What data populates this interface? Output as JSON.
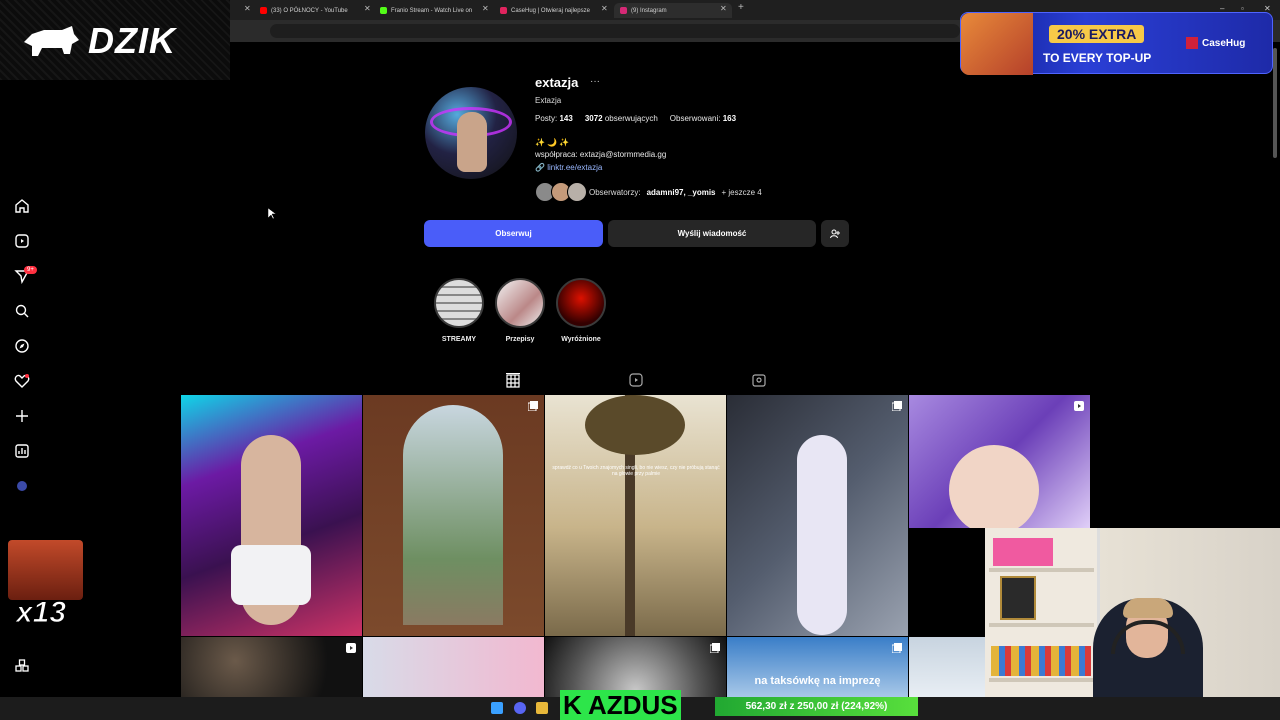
{
  "browser": {
    "tabs": [
      {
        "title": "(33) O PÓŁNOCY - YouTube",
        "color": "#ff0000"
      },
      {
        "title": "Franio Stream - Watch Live on",
        "color": "#53fc18"
      },
      {
        "title": "CaseHug | Otwieraj najlepsze ",
        "color": "#e0245e"
      },
      {
        "title": "(9) Instagram",
        "color": "#d62976"
      }
    ]
  },
  "overlay": {
    "brand": "DZIK",
    "casehug": {
      "pct": "20% EXTRA",
      "sub": "TO EVERY TOP-UP",
      "brand": "CaseHug"
    },
    "multiplier": "x13",
    "ticker_name": "K AZDUS",
    "donation": "562,30 zł z 250,00 zł (224,92%)"
  },
  "sidebar": {
    "badge": "9+"
  },
  "profile": {
    "username": "extazja",
    "more": "···",
    "full_name": "Extazja",
    "posts_label": "Posty:",
    "posts": "143",
    "followers": "3072",
    "followers_label": "obserwujących",
    "following_label": "Obserwowani:",
    "following": "163",
    "emoji_line": "✨ 🌙 ✨",
    "bio": "współpraca: extazja@stormmedia.gg",
    "link": "linktr.ee/extazja",
    "followed_by_label": "Obserwatorzy:",
    "followed_by_names": "adamni97, _yomis",
    "followed_by_more": "+ jeszcze 4",
    "follow_button": "Obserwuj",
    "message_button": "Wyślij wiadomość"
  },
  "highlights": [
    {
      "label": "STREAMY"
    },
    {
      "label": "Przepisy"
    },
    {
      "label": "Wyróżnione"
    }
  ],
  "posts_grid": {
    "caption_3": "sprawdź co u Twoich znajomych singli, bo nie wiesz, czy nie próbują stanąć na głowie przy palmie",
    "caption_9": "na taksówkę na imprezę"
  }
}
